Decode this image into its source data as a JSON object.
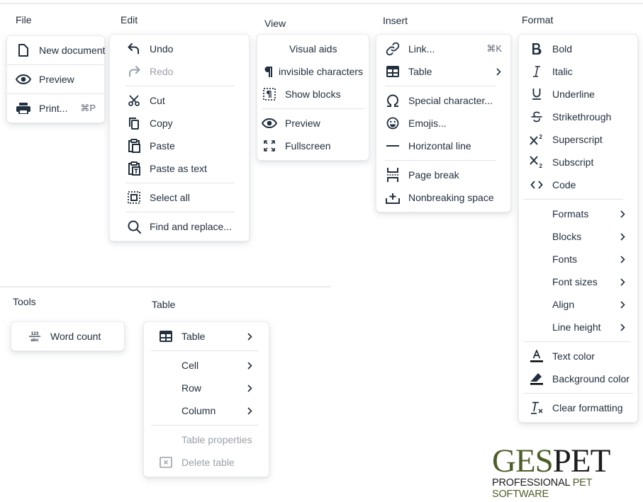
{
  "menus": {
    "file": {
      "title": "File",
      "items": [
        {
          "label": "New document",
          "icon": "new-document-icon"
        },
        {
          "label": "Preview",
          "icon": "eye-icon"
        },
        {
          "label": "Print...",
          "icon": "print-icon",
          "shortcut": "⌘P"
        }
      ]
    },
    "edit": {
      "title": "Edit",
      "items": [
        {
          "label": "Undo",
          "icon": "undo-icon"
        },
        {
          "label": "Redo",
          "icon": "redo-icon",
          "disabled": true
        },
        {
          "label": "Cut",
          "icon": "cut-icon"
        },
        {
          "label": "Copy",
          "icon": "copy-icon"
        },
        {
          "label": "Paste",
          "icon": "paste-icon"
        },
        {
          "label": "Paste as text",
          "icon": "paste-text-icon"
        },
        {
          "label": "Select all",
          "icon": "select-all-icon"
        },
        {
          "label": "Find and replace...",
          "icon": "search-icon"
        }
      ]
    },
    "view": {
      "title": "View",
      "items": [
        {
          "label": "Visual aids"
        },
        {
          "label": "invisible characters",
          "icon": "pilcrow-icon"
        },
        {
          "label": "Show blocks",
          "icon": "show-blocks-icon"
        },
        {
          "label": "Preview",
          "icon": "eye-icon"
        },
        {
          "label": "Fullscreen",
          "icon": "fullscreen-icon"
        }
      ]
    },
    "insert": {
      "title": "Insert",
      "items": [
        {
          "label": "Link...",
          "icon": "link-icon",
          "shortcut": "⌘K"
        },
        {
          "label": "Table",
          "icon": "table-icon",
          "submenu": true
        },
        {
          "label": "Special character...",
          "icon": "omega-icon"
        },
        {
          "label": "Emojis...",
          "icon": "emoji-icon"
        },
        {
          "label": "Horizontal line",
          "icon": "horizontal-line-icon"
        },
        {
          "label": "Page break",
          "icon": "page-break-icon"
        },
        {
          "label": "Nonbreaking space",
          "icon": "nonbreaking-space-icon"
        }
      ]
    },
    "format": {
      "title": "Format",
      "items": [
        {
          "label": "Bold",
          "icon": "bold-icon"
        },
        {
          "label": "Italic",
          "icon": "italic-icon"
        },
        {
          "label": "Underline",
          "icon": "underline-icon"
        },
        {
          "label": "Strikethrough",
          "icon": "strikethrough-icon"
        },
        {
          "label": "Superscript",
          "icon": "superscript-icon"
        },
        {
          "label": "Subscript",
          "icon": "subscript-icon"
        },
        {
          "label": "Code",
          "icon": "code-icon"
        },
        {
          "label": "Formats",
          "submenu": true
        },
        {
          "label": "Blocks",
          "submenu": true
        },
        {
          "label": "Fonts",
          "submenu": true
        },
        {
          "label": "Font sizes",
          "submenu": true
        },
        {
          "label": "Align",
          "submenu": true
        },
        {
          "label": "Line height",
          "submenu": true
        },
        {
          "label": "Text color",
          "icon": "text-color-icon"
        },
        {
          "label": "Background color",
          "icon": "highlight-icon"
        },
        {
          "label": "Clear formatting",
          "icon": "clear-formatting-icon"
        }
      ]
    },
    "tools": {
      "title": "Tools",
      "items": [
        {
          "label": "Word count",
          "icon": "word-count-icon"
        }
      ]
    },
    "table": {
      "title": "Table",
      "items": [
        {
          "label": "Table",
          "icon": "table-icon",
          "submenu": true
        },
        {
          "label": "Cell",
          "submenu": true
        },
        {
          "label": "Row",
          "submenu": true
        },
        {
          "label": "Column",
          "submenu": true
        },
        {
          "label": "Table properties",
          "disabled": true
        },
        {
          "label": "Delete table",
          "icon": "delete-table-icon",
          "disabled": true
        }
      ]
    }
  },
  "logo": {
    "main_green": "GES",
    "main_dark": "PET",
    "sub_dark": "PROFESSIONAL ",
    "sub_green": "PET SOFTWARE"
  },
  "colors": {
    "text": "#222f3e",
    "disabled": "#9aa1a9",
    "logo_green": "#4d5e2a"
  },
  "glyphs": {
    "chevron": "›",
    "word_count_top": "123",
    "word_count_bottom": "abc"
  }
}
